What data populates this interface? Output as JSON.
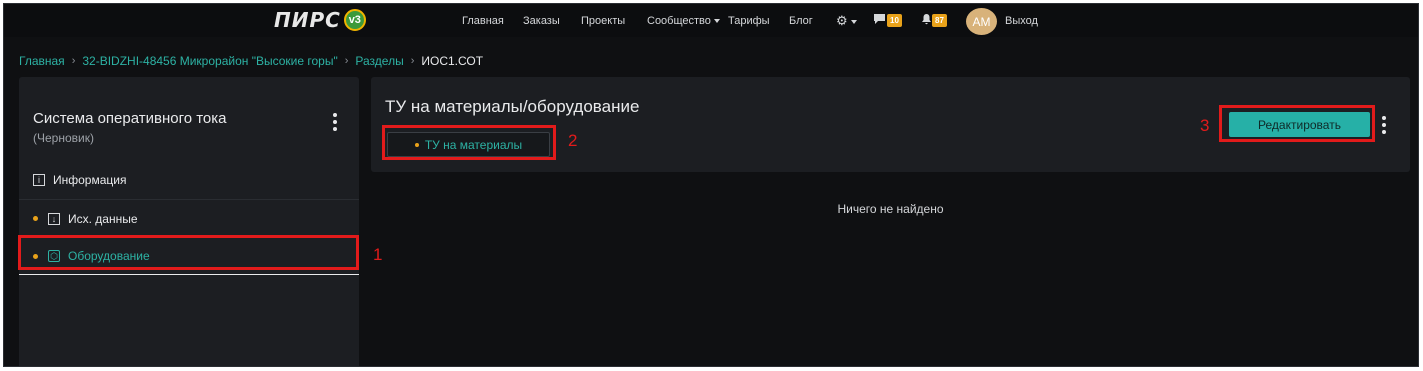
{
  "nav": {
    "logo_text": "ПИРС",
    "logo_version": "v3",
    "links": [
      "Главная",
      "Заказы",
      "Проекты",
      "Сообщество",
      "Тарифы",
      "Блог"
    ],
    "messages_count": "10",
    "notifications_count": "87",
    "avatar_initials": "АМ",
    "logout": "Выход"
  },
  "breadcrumb": {
    "items": [
      "Главная",
      "32-BIDZHI-48456 Микрорайон \"Высокие горы\"",
      "Разделы"
    ],
    "current": "ИОС1.СОТ",
    "separator": "›"
  },
  "sidebar": {
    "title": "Система оперативного тока",
    "subtitle": "(Черновик)",
    "items": [
      {
        "label": "Информация",
        "icon": "info-icon"
      },
      {
        "label": "Исх. данные",
        "icon": "download-icon"
      },
      {
        "label": "Оборудование",
        "icon": "box-icon"
      }
    ]
  },
  "main": {
    "title": "ТУ на материалы/оборудование",
    "tag_label": "ТУ на материалы",
    "edit_button": "Редактировать",
    "empty_text": "Ничего не найдено"
  },
  "annotations": [
    "1",
    "2",
    "3"
  ],
  "colors": {
    "accent": "#2db2a4",
    "button": "#26b0a7",
    "dot": "#e9a21a",
    "annotation": "#e21b1b",
    "background": "#0f1012",
    "panel": "#1c1e22"
  }
}
